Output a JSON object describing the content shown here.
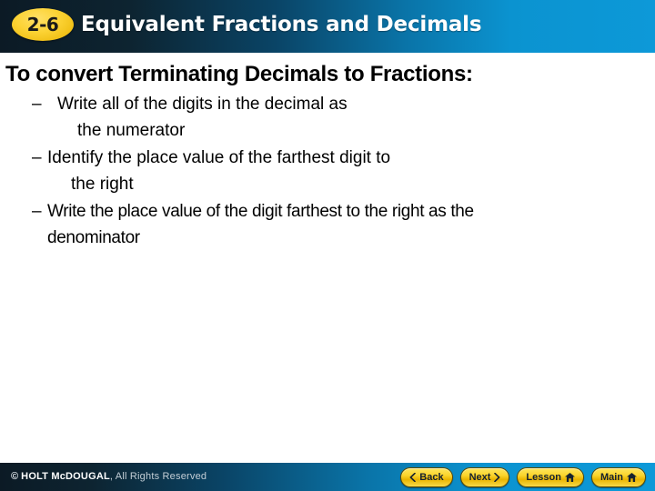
{
  "header": {
    "badge_label": "2-6",
    "title": "Equivalent Fractions and Decimals",
    "gradient_start_color": "#0c1a25",
    "gradient_end_color": "#0d99d8",
    "badge_color": "#fcd335"
  },
  "slide": {
    "heading": "To convert Terminating Decimals to Fractions:",
    "bullets": [
      {
        "marker": "–",
        "line1": "Write all of the digits in the decimal as",
        "line2": "the numerator"
      },
      {
        "marker": "–",
        "line1": "Identify the place value of the farthest digit to",
        "line2": "the right"
      },
      {
        "marker": "–",
        "line1": "Write the place value of the digit farthest to the right as the",
        "line2": "denominator"
      }
    ]
  },
  "footer": {
    "copyright_mark": "©",
    "copyright_bold": "HOLT McDOUGAL",
    "copyright_light": ", All Rights Reserved",
    "buttons": [
      {
        "label": "Back",
        "icon": "chevron-left-icon"
      },
      {
        "label": "Next",
        "icon": "chevron-right-icon"
      },
      {
        "label": "Lesson",
        "icon": "home-icon"
      },
      {
        "label": "Main",
        "icon": "home-icon"
      }
    ],
    "button_color": "#fbd62e",
    "gradient_start_color": "#0c1a25",
    "gradient_end_color": "#0d99d8"
  }
}
